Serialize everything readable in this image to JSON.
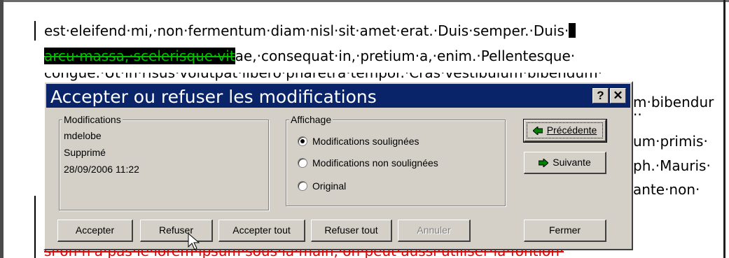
{
  "document": {
    "line1": "est·eleifend·mi,·non·fermentum·diam·nisl·sit·amet·erat.·Duis·semper.·Duis·",
    "line2_deleted": "arcu·massa,·scelerisque·vit",
    "line2_rest": "ae,·consequat·in,·pretium·a,·enim.·Pellentesque·",
    "line3_partial": "congue.·Ut·in·risus·volutpat·libero·pharetra·tempor.·Cras·vestibulum·bibendum·",
    "right_fragment_1": "m·bibendur",
    "right_fragment_2": "..",
    "right_fragment_3": "um·primis·",
    "right_fragment_4": "ph.·Mauris·",
    "right_fragment_5": "ante·non·",
    "bottom_deleted": "si·on·n'a·pas·le·lorem·ipsum·sous·la·main,·on·peut·aussi·utiliser·la·fontion·"
  },
  "dialog": {
    "title": "Accepter ou refuser les modifications",
    "help_label": "?",
    "close_label": "✕",
    "modifications": {
      "group_label": "Modifications",
      "author": "mdelobe",
      "action": "Supprimé",
      "datetime": "28/09/2006 11:22"
    },
    "affichage": {
      "group_label": "Affichage",
      "options": [
        {
          "label": "Modifications soulignées",
          "checked": true
        },
        {
          "label": "Modifications non soulignées",
          "checked": false
        },
        {
          "label": "Original",
          "checked": false
        }
      ]
    },
    "buttons": {
      "precedente": "Précédente",
      "suivante": "Suivante",
      "accepter": "Accepter",
      "refuser": "Refuser",
      "accepter_tout": "Accepter tout",
      "refuser_tout": "Refuser tout",
      "annuler": "Annuler",
      "fermer": "Fermer"
    }
  },
  "colors": {
    "titlebar": "#0a246a",
    "dialog_face": "#d4d0c8",
    "deleted_text": "#00c000",
    "deleted_highlight": "#000000",
    "deleted_red": "#e00000"
  }
}
